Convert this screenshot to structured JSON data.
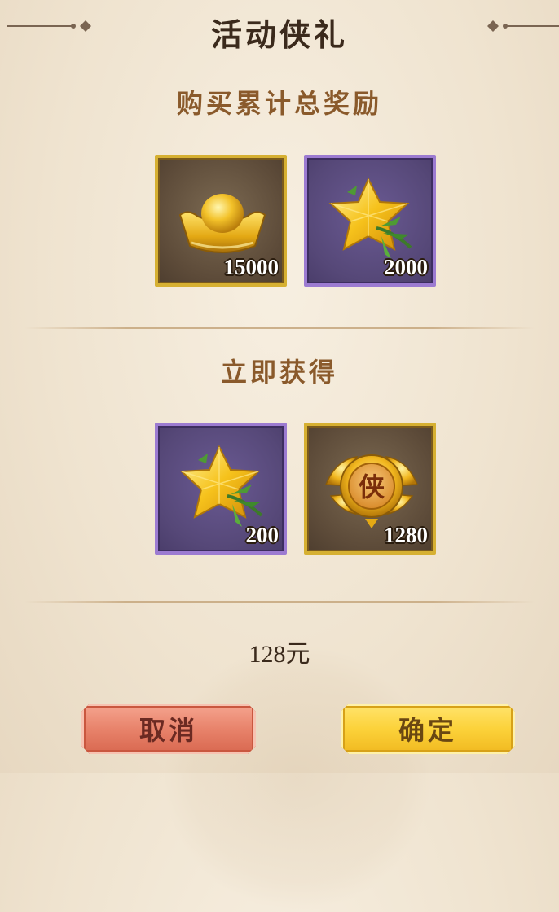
{
  "dialog": {
    "title": "活动侠礼"
  },
  "cumulative": {
    "heading": "购买累计总奖励",
    "items": [
      {
        "icon": "gold-ingot-icon",
        "quantity": "15000",
        "frame": "gold"
      },
      {
        "icon": "yellow-crystal-bamboo-icon",
        "quantity": "2000",
        "frame": "purple"
      }
    ]
  },
  "instant": {
    "heading": "立即获得",
    "items": [
      {
        "icon": "yellow-crystal-bamboo-icon",
        "quantity": "200",
        "frame": "purple"
      },
      {
        "icon": "xia-emblem-icon",
        "quantity": "1280",
        "frame": "gold",
        "emblem_char": "侠"
      }
    ]
  },
  "price": "128元",
  "buttons": {
    "cancel_label": "取消",
    "confirm_label": "确定"
  },
  "colors": {
    "gold_frame": "#d6b032",
    "purple_frame": "#9c7bd1",
    "cancel_button": "#e8836b",
    "confirm_button": "#fcd23a",
    "section_heading": "#8a5a2b"
  }
}
